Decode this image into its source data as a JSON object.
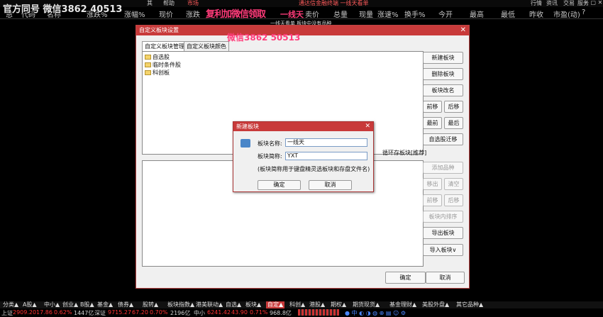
{
  "topbar": {
    "fragment_left": "其",
    "help": "帮助",
    "market": "市场",
    "broker_notice": "通达信金融终端   一线天看单",
    "trade": "行情",
    "news": "资讯",
    "trading": "交易",
    "service": "服务",
    "window_controls": "— ▢ ✕"
  },
  "header_cols": [
    "代码",
    "名称",
    "涨跌",
    "现价",
    "涨跌",
    "买价",
    "卖价",
    "总量",
    "现量",
    "涨速%",
    "换手%",
    "今开",
    "最高",
    "最低",
    "昨收",
    "市盈(动)"
  ],
  "header_extra": {
    "rise_pct": "涨跌%",
    "amplitude": "涨幅%",
    "code_prefix": "恩",
    "question": "?"
  },
  "watermarks": {
    "main": "官方同号 微信3862 40513",
    "middle": "复利加微信领取",
    "middle2": "一线天",
    "sub": "微信3862 50513",
    "qr_hint": "一线天看单 板块中没有品种"
  },
  "dialog": {
    "title": "自定义板块设置",
    "tabs": [
      "自定义板块管理",
      "自定义板块颜色"
    ],
    "tree": [
      "自选股",
      "临时条件股",
      "科创板"
    ],
    "right_buttons": {
      "new": "新建板块",
      "delete": "删除板块",
      "rename": "板块改名",
      "prev": "前移",
      "next": "后移",
      "top": "最前",
      "bottom": "最后",
      "move_to_own": "自选股迁移"
    },
    "save_hint": "循环存板块[推荐]",
    "lower_buttons": {
      "add": "添加品种",
      "remove": "移出",
      "clear": "清空",
      "up": "前移",
      "down": "后移",
      "sort": "板块内排序",
      "export": "导出板块",
      "import": "导入板块∨"
    },
    "ok": "确定",
    "cancel": "取消"
  },
  "subdialog": {
    "title": "新建板块",
    "name_label": "板块名称:",
    "name_value": "一线天",
    "short_label": "板块简称:",
    "short_value": "YXT",
    "note": "(板块简称用于键盘精灵选板块和存盘文件名)",
    "ok": "确定",
    "cancel": "取消"
  },
  "tabbar": [
    "分类▲",
    "A股▲",
    "中小▲",
    "创业▲",
    "B股▲",
    "基金▲",
    "债券▲",
    "股转▲",
    "板块指数▲",
    "港美联动▲",
    "自选▲",
    "板块▲",
    "自定▲",
    "科创▲",
    "港股▲",
    "期权▲",
    "期货现货▲",
    "基金理财▲",
    "美股外盘▲",
    "其它品种▲"
  ],
  "ticker": {
    "sh_label": "上证",
    "sh_value": "2909.20",
    "sh_change": "17.86",
    "sh_pct": "0.62%",
    "sh_amount": "1447亿",
    "sz_label": "深证",
    "sz_value": "9715.27",
    "sz_change": "67.20",
    "sz_pct": "0.70%",
    "sz_amount": "2196亿",
    "zx_label": "中小",
    "zx_value": "6241.42",
    "zx_change": "43.90",
    "zx_pct": "0.71%",
    "zx_amount": "968.8亿"
  },
  "colors": {
    "accent": "#c83a3a",
    "up": "#ff3333"
  }
}
